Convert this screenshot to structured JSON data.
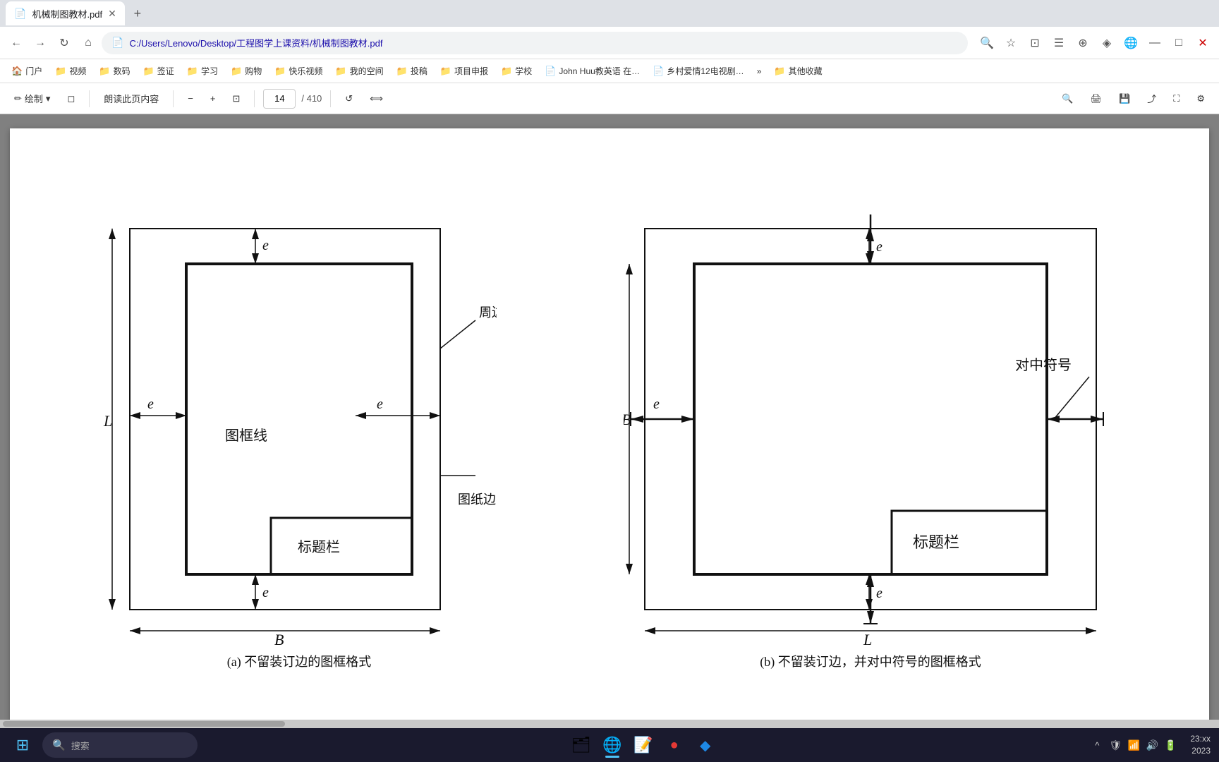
{
  "browser": {
    "tab": {
      "title": "机械制图教材.pdf",
      "close_icon": "✕",
      "new_tab_icon": "+"
    },
    "address": {
      "back_icon": "←",
      "forward_icon": "→",
      "refresh_icon": "↻",
      "home_icon": "⌂",
      "url": "C:/Users/Lenovo/Desktop/工程图学上课资料/机械制图教材.pdf",
      "security_icon": "📄",
      "star_icon": "☆",
      "bookmark_icon": "⛉",
      "extension_icon": "🧩",
      "collection_icon": "☰",
      "copilot_icon": "◈",
      "edge_icon": "⊕"
    },
    "bookmarks": [
      {
        "icon": "🏠",
        "label": "门户"
      },
      {
        "icon": "📁",
        "label": "视频"
      },
      {
        "icon": "📁",
        "label": "数码"
      },
      {
        "icon": "📁",
        "label": "签证"
      },
      {
        "icon": "📁",
        "label": "学习"
      },
      {
        "icon": "📁",
        "label": "购物"
      },
      {
        "icon": "📁",
        "label": "快乐视频"
      },
      {
        "icon": "📁",
        "label": "我的空间"
      },
      {
        "icon": "📁",
        "label": "投稿"
      },
      {
        "icon": "📁",
        "label": "项目申报"
      },
      {
        "icon": "📁",
        "label": "学校"
      },
      {
        "icon": "📄",
        "label": "John Huu教英语 在…"
      },
      {
        "icon": "📄",
        "label": "乡村爱情12电视剧…"
      },
      {
        "icon": "»",
        "label": ""
      },
      {
        "icon": "📁",
        "label": "其他收藏"
      }
    ]
  },
  "pdf_toolbar": {
    "draw_icon": "✏",
    "draw_label": "绘制",
    "erase_icon": "◻",
    "read_label": "朗读此页内容",
    "zoom_out": "−",
    "zoom_in": "+",
    "fit_icon": "⊡",
    "page_current": "14",
    "page_total": "/ 410",
    "rotate_icon": "↺",
    "fit_width_icon": "⟺",
    "search_icon": "🔍",
    "print_icon": "🖨",
    "save_icon": "💾",
    "share_icon": "⤴",
    "expand_icon": "⛶",
    "settings_icon": "⚙"
  },
  "diagram_left": {
    "label": "(a) 不留装订边的图框格式",
    "e_top": "e",
    "e_left": "e",
    "e_right": "e",
    "e_bottom": "e",
    "dim_L": "L",
    "dim_B": "B",
    "label_border": "图纸边界",
    "label_frame": "图框线",
    "label_titleblock": "标题栏",
    "label_margin": "周边"
  },
  "diagram_right": {
    "label": "(b) 不留装订边，并对中符号的图框格式",
    "e_top": "e",
    "e_left": "e",
    "e_bottom": "e",
    "dim_L": "L",
    "dim_B": "B",
    "label_center": "对中符号",
    "label_titleblock": "标题栏"
  },
  "taskbar": {
    "start_icon": "⊞",
    "search_placeholder": "搜索",
    "search_icon": "🔍",
    "apps": [
      {
        "icon": "⊞",
        "label": "start",
        "active": false
      },
      {
        "icon": "🔍",
        "label": "search",
        "active": false
      },
      {
        "icon": "🗂",
        "label": "file-explorer",
        "active": false
      },
      {
        "icon": "🌐",
        "label": "edge-browser",
        "active": true
      },
      {
        "icon": "📝",
        "label": "notepad",
        "active": false
      },
      {
        "icon": "🔴",
        "label": "app1",
        "active": false
      },
      {
        "icon": "🔷",
        "label": "app2",
        "active": false
      }
    ],
    "tray_icons": [
      "^",
      "🛡",
      "📶",
      "🔊",
      "🔋"
    ],
    "time": "23",
    "date": "2023"
  },
  "colors": {
    "browser_bg": "#dee1e6",
    "tab_active_bg": "#ffffff",
    "address_bar_bg": "#ffffff",
    "pdf_toolbar_bg": "#ffffff",
    "pdf_page_bg": "#ffffff",
    "pdf_bg": "#808080",
    "taskbar_bg": "#1a1a2e",
    "accent": "#4fc3f7"
  }
}
